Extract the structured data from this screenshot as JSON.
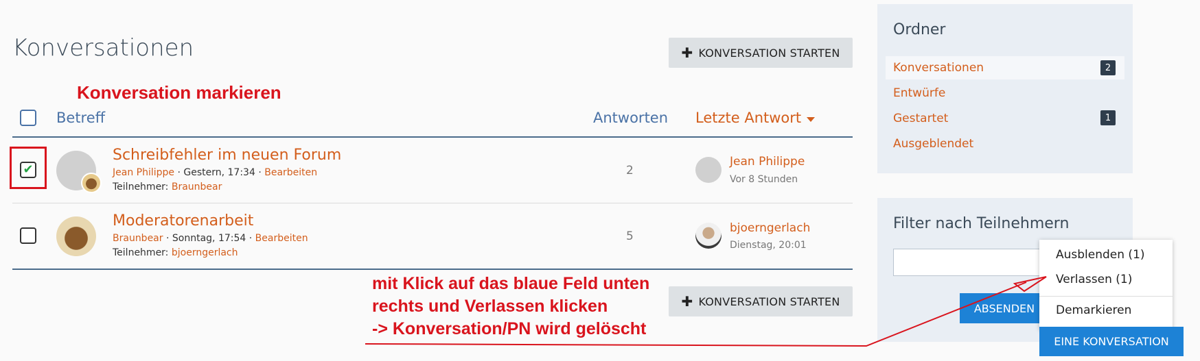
{
  "page": {
    "title": "Konversationen",
    "start_button": "KONVERSATION STARTEN"
  },
  "annotations": {
    "top": "Konversation markieren",
    "bottom_lines": [
      "mit Klick auf das blaue Feld unten",
      "rechts und Verlassen klicken",
      "-> Konversation/PN wird gelöscht"
    ]
  },
  "table": {
    "headers": {
      "subject": "Betreff",
      "replies": "Antworten",
      "last_reply": "Letzte Antwort"
    },
    "rows": [
      {
        "checked": true,
        "title": "Schreibfehler im neuen Forum",
        "author": "Jean Philippe",
        "sep": "·",
        "date": "Gestern, 17:34",
        "edit": "Bearbeiten",
        "participants_label": "Teilnehmer:",
        "participant": "Braunbear",
        "replies": "2",
        "last_user": "Jean Philippe",
        "last_time": "Vor 8 Stunden"
      },
      {
        "checked": false,
        "title": "Moderatorenarbeit",
        "author": "Braunbear",
        "sep": "·",
        "date": "Sonntag, 17:54",
        "edit": "Bearbeiten",
        "participants_label": "Teilnehmer:",
        "participant": "bjoerngerlach",
        "replies": "5",
        "last_user": "bjoerngerlach",
        "last_time": "Dienstag, 20:01"
      }
    ]
  },
  "sidebar": {
    "folder_title": "Ordner",
    "folders": [
      {
        "label": "Konversationen",
        "badge": "2"
      },
      {
        "label": "Entwürfe",
        "badge": ""
      },
      {
        "label": "Gestartet",
        "badge": "1"
      },
      {
        "label": "Ausgeblendet",
        "badge": ""
      }
    ],
    "filter_title": "Filter nach Teilnehmern",
    "submit_label": "ABSENDEN"
  },
  "menu": {
    "items": [
      "Ausblenden (1)",
      "Verlassen (1)",
      "Demarkieren"
    ],
    "action_button": "EINE KONVERSATION"
  },
  "colors": {
    "accent_orange": "#d35e1c",
    "header_blue": "#4a72a6",
    "annotation_red": "#d9141d",
    "action_blue": "#1d82d6"
  }
}
